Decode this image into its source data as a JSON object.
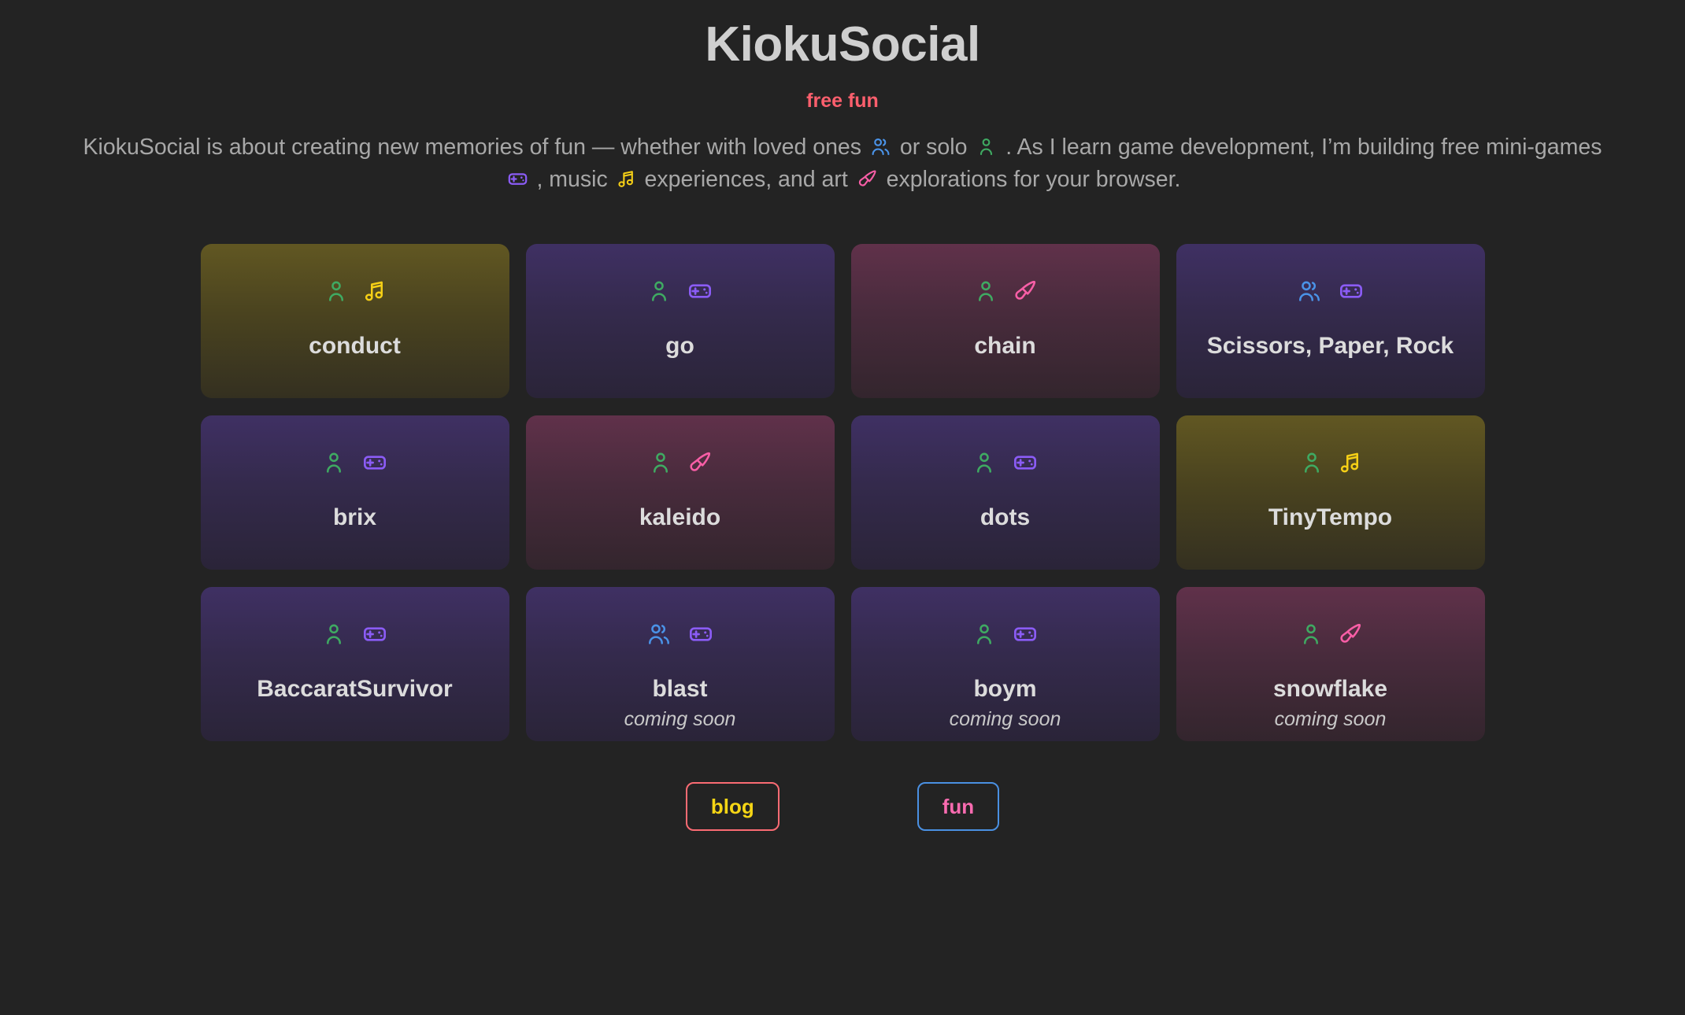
{
  "header": {
    "title": "KiokuSocial",
    "tagline": "free fun",
    "description_part1": "KiokuSocial is about creating new memories of fun — whether with loved ones",
    "description_part2": "or solo",
    "description_part3": ". As I learn game development, I’m building free mini-games",
    "description_part4": ", music",
    "description_part5": "experiences, and art",
    "description_part6": "explorations for your browser."
  },
  "icon_colors": {
    "solo": "#3faa62",
    "multiplayer": "#4a93e8",
    "gamepad": "#8b5cf6",
    "music": "#f5cf16",
    "art": "#f85ea6"
  },
  "cards": [
    {
      "title": "conduct",
      "theme": "olive",
      "players": "solo",
      "kind": "music",
      "status": ""
    },
    {
      "title": "go",
      "theme": "purple",
      "players": "solo",
      "kind": "gamepad",
      "status": ""
    },
    {
      "title": "chain",
      "theme": "maroon",
      "players": "solo",
      "kind": "art",
      "status": ""
    },
    {
      "title": "Scissors, Paper, Rock",
      "theme": "purple",
      "players": "multiplayer",
      "kind": "gamepad",
      "status": ""
    },
    {
      "title": "brix",
      "theme": "purple",
      "players": "solo",
      "kind": "gamepad",
      "status": ""
    },
    {
      "title": "kaleido",
      "theme": "maroon",
      "players": "solo",
      "kind": "art",
      "status": ""
    },
    {
      "title": "dots",
      "theme": "purple",
      "players": "solo",
      "kind": "gamepad",
      "status": ""
    },
    {
      "title": "TinyTempo",
      "theme": "olive",
      "players": "solo",
      "kind": "music",
      "status": ""
    },
    {
      "title": "BaccaratSurvivor",
      "theme": "purple",
      "players": "solo",
      "kind": "gamepad",
      "status": ""
    },
    {
      "title": "blast",
      "theme": "purple",
      "players": "multiplayer",
      "kind": "gamepad",
      "status": "coming soon"
    },
    {
      "title": "boym",
      "theme": "purple",
      "players": "solo",
      "kind": "gamepad",
      "status": "coming soon"
    },
    {
      "title": "snowflake",
      "theme": "maroon",
      "players": "solo",
      "kind": "art",
      "status": "coming soon"
    }
  ],
  "footer": {
    "blog_label": "blog",
    "fun_label": "fun",
    "blog_border_color": "#fa6b73",
    "blog_text_color": "#f5d515",
    "fun_border_color": "#4a90e2",
    "fun_text_color": "#f96bb0"
  }
}
